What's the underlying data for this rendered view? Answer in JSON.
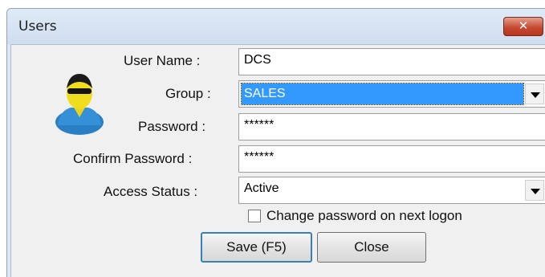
{
  "window": {
    "title": "Users",
    "close_glyph": "✕"
  },
  "form": {
    "user_name": {
      "label": "User Name :",
      "value": "DCS"
    },
    "group": {
      "label": "Group :",
      "value": "SALES"
    },
    "password": {
      "label": "Password :",
      "value": "******"
    },
    "confirm_password": {
      "label": "Confirm Password :",
      "value": "******"
    },
    "access_status": {
      "label": "Access Status :",
      "value": "Active"
    },
    "change_password": {
      "label": "Change password on next logon",
      "checked": false
    }
  },
  "buttons": {
    "save": "Save (F5)",
    "close": "Close"
  },
  "colors": {
    "selection": "#3399ff",
    "close_button": "#c64a33"
  },
  "icons": {
    "avatar": "user-avatar-icon",
    "dropdown": "chevron-down-icon",
    "close": "close-icon"
  }
}
